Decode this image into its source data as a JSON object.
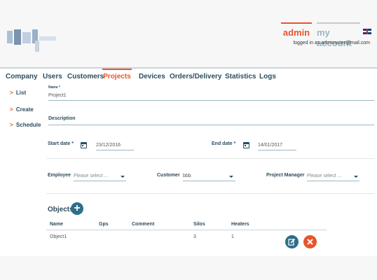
{
  "header": {
    "nav_admin": "admin",
    "nav_account": "my account",
    "logged_in_text": "logged in as adminsuter@mail.com"
  },
  "main_nav": [
    {
      "label": "Company",
      "active": false
    },
    {
      "label": "Users",
      "active": false
    },
    {
      "label": "Customers",
      "active": false
    },
    {
      "label": "Projects",
      "active": true
    },
    {
      "label": "Devices",
      "active": false
    },
    {
      "label": "Orders/Delivery",
      "active": false
    },
    {
      "label": "Statistics",
      "active": false
    },
    {
      "label": "Logs",
      "active": false
    }
  ],
  "side_menu": [
    {
      "label": "List"
    },
    {
      "label": "Create"
    },
    {
      "label": "Schedule"
    }
  ],
  "form": {
    "name_label": "Name *",
    "name_value": "Project1",
    "description_label": "Description",
    "description_value": "",
    "start_label": "Start date *",
    "start_value": "23/12/2016",
    "end_label": "End date *",
    "end_value": "14/01/2017",
    "employee_label": "Employee",
    "employee_value": "Please select ...",
    "customer_label": "Customer",
    "customer_value": "bbb",
    "pm_label": "Project Manager",
    "pm_value": "Please select ..."
  },
  "objects": {
    "title": "Objects",
    "add_label": "+",
    "columns": [
      "Name",
      "Gps",
      "Comment",
      "Silos",
      "Heaters"
    ],
    "rows": [
      {
        "name": "Object1",
        "gps": "",
        "comment": "",
        "silos": "3",
        "heaters": "1"
      }
    ]
  },
  "colors": {
    "accent": "#e8542a",
    "primary": "#2d6e88",
    "nav_text": "#2d4d5e"
  }
}
